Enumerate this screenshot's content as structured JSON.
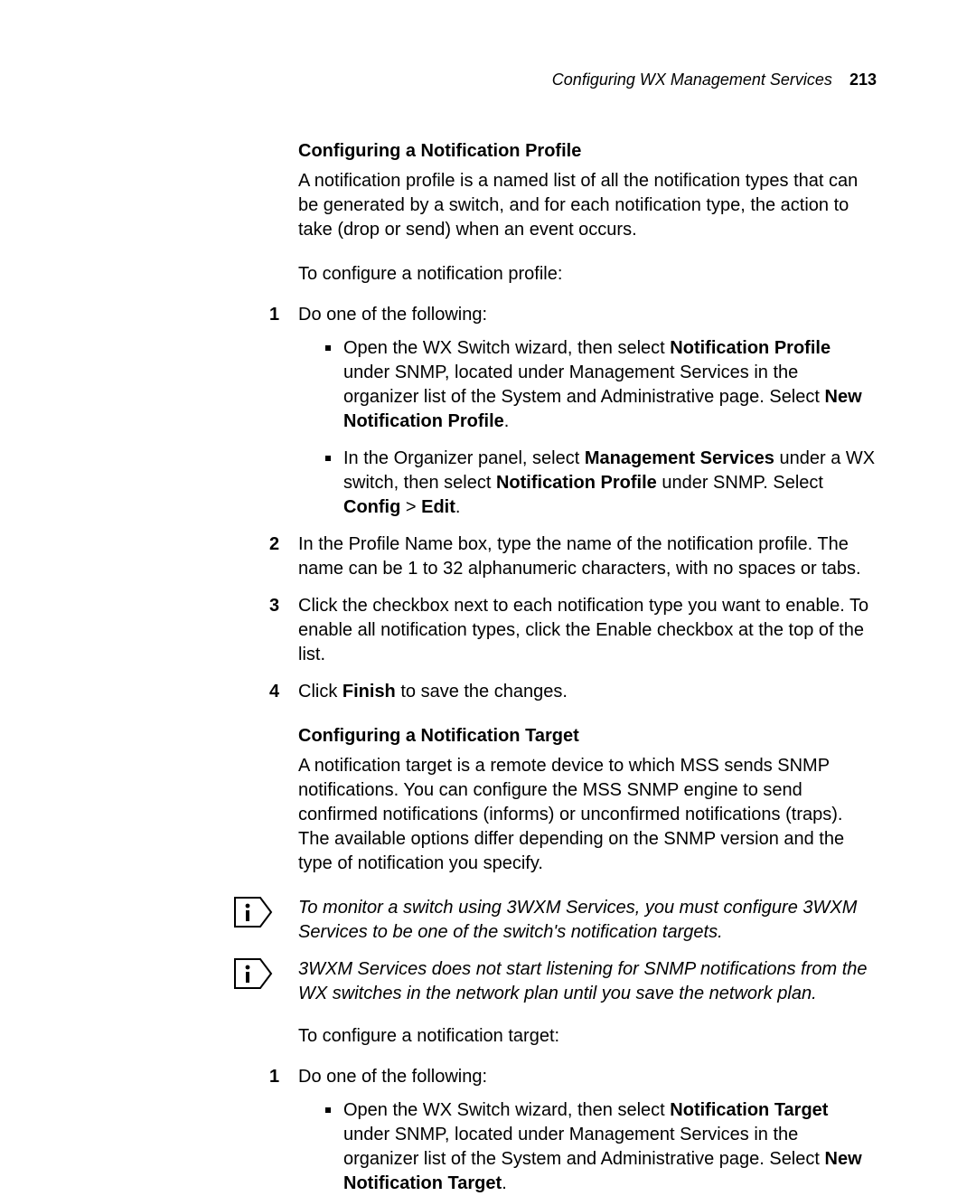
{
  "header": {
    "title": "Configuring WX Management Services",
    "page_number": "213"
  },
  "section1": {
    "heading": "Configuring a Notification Profile",
    "intro": "A notification profile is a named list of all the notification types that can be generated by a switch, and for each notification type, the action to take (drop or send) when an event occurs.",
    "lead": "To configure a notification profile:",
    "step1_text": "Do one of the following:",
    "bullet1_pre": "Open the WX Switch wizard, then select ",
    "bullet1_b1": "Notification Profile",
    "bullet1_mid": " under SNMP, located under Management Services in the organizer list of the System and Administrative page. Select ",
    "bullet1_b2": "New Notification Profile",
    "bullet1_post": ".",
    "bullet2_pre": "In the Organizer panel, select ",
    "bullet2_b1": "Management Services",
    "bullet2_mid1": " under a WX switch, then select ",
    "bullet2_b2": "Notification Profile",
    "bullet2_mid2": " under SNMP. Select ",
    "bullet2_b3": "Config",
    "bullet2_gt": " > ",
    "bullet2_b4": "Edit",
    "bullet2_post": ".",
    "step2_text": "In the Profile Name box, type the name of the notification profile. The name can be 1 to 32 alphanumeric characters, with no spaces or tabs.",
    "step3_text": "Click the checkbox next to each notification type you want to enable. To enable all notification types, click the Enable checkbox at the top of the list.",
    "step4_pre": "Click ",
    "step4_b": "Finish",
    "step4_post": " to save the changes."
  },
  "section2": {
    "heading": "Configuring a Notification Target",
    "intro": "A notification target is a remote device to which MSS sends SNMP notifications. You can configure the MSS SNMP engine to send confirmed notifications (informs) or unconfirmed notifications (traps). The available options differ depending on the SNMP version and the type of notification you specify.",
    "note1": "To monitor a switch using 3WXM Services, you must configure 3WXM Services to be one of the switch's notification targets.",
    "note2": "3WXM Services does not start listening for SNMP notifications from the WX switches in the network plan until you save the network plan.",
    "lead": "To configure a notification target:",
    "step1_text": "Do one of the following:",
    "bullet1_pre": "Open the WX Switch wizard, then select ",
    "bullet1_b1": "Notification Target",
    "bullet1_mid": " under SNMP, located under Management Services in the organizer list of the System and Administrative page. Select ",
    "bullet1_b2": "New Notification Target",
    "bullet1_post": "."
  },
  "nums": {
    "n1": "1",
    "n2": "2",
    "n3": "3",
    "n4": "4"
  }
}
